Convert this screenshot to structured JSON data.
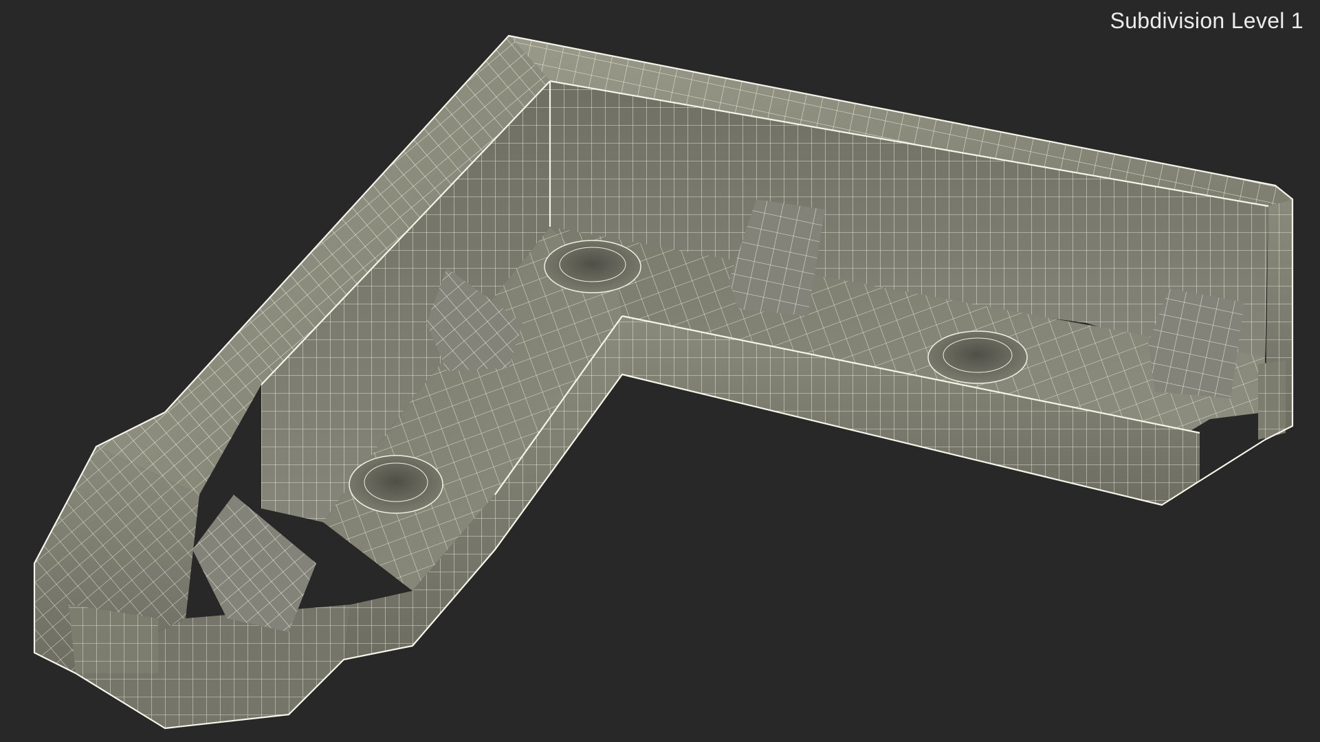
{
  "viewport": {
    "background_color": "#282828",
    "overlay_label": "Subdivision Level 1"
  },
  "model": {
    "render_style": "wireframe-on-shaded",
    "surface_color": "#8c8c7d",
    "wire_color": "#f2f1e4",
    "features": {
      "mounting_holes": 3,
      "gussets": 5
    }
  }
}
